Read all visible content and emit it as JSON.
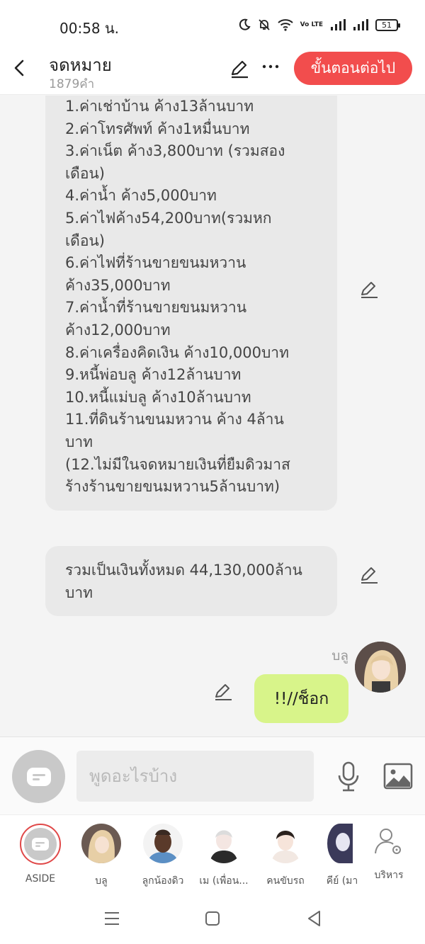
{
  "status_bar": {
    "time": "00:58 น.",
    "battery": "51",
    "network_label": "Vo LTE"
  },
  "header": {
    "title": "จดหมาย",
    "subtitle": "1879คำ",
    "next_button": "ขั้นตอนต่อไป"
  },
  "messages": {
    "first": {
      "lines": [
        "1.ค่าเช่าบ้าน ค้าง13ล้านบาท",
        "2.ค่าโทรศัพท์ ค้าง1หมื่นบาท",
        "3.ค่าเน็ต ค้าง3,800บาท (รวมสอง",
        "เดือน)",
        "4.ค่าน้ำ ค้าง5,000บาท",
        "5.ค่าไฟค้าง54,200บาท(รวมหก",
        "เดือน)",
        "6.ค่าไฟที่ร้านขายขนมหวาน",
        "ค้าง35,000บาท",
        "7.ค่าน้ำที่ร้านขายขนมหวาน",
        "ค้าง12,000บาท",
        "8.ค่าเครื่องคิดเงิน ค้าง10,000บาท",
        "9.หนี้พ่อบลู ค้าง12ล้านบาท",
        "10.หนี้แม่บลู ค้าง10ล้านบาท",
        "11.ที่ดินร้านขนมหวาน ค้าง 4ล้าน",
        "บาท",
        "(12.ไม่มีในจดหมายเงินที่ยืมดิวมาส",
        "ร้างร้านขายขนมหวาน5ล้านบาท)"
      ]
    },
    "second": {
      "lines": [
        "รวมเป็นเงินทั้งหมด 44,130,000ล้าน",
        "บาท"
      ]
    },
    "reply": {
      "sender": "บลู",
      "text": "!!//ช็อก"
    }
  },
  "input": {
    "placeholder": "พูดอะไรบ้าง"
  },
  "characters": [
    {
      "label": "ASIDE",
      "type": "aside"
    },
    {
      "label": "บลู",
      "color": "#6b5a52",
      "hair": "#e7cfa6"
    },
    {
      "label": "ลูกน้องดิว",
      "color": "#5b8fc4",
      "hair": "#3a2a22"
    },
    {
      "label": "เม (เพื่อน...",
      "color": "#2b2b2b",
      "hair": "#dcdcdc"
    },
    {
      "label": "คนขับรถ",
      "color": "#f2e8e2",
      "hair": "#2a211d"
    },
    {
      "label": "คีย์ (มา",
      "color": "#3b3a5a",
      "hair": "#e6e6f2"
    },
    {
      "label": "บริหาร",
      "type": "manage"
    }
  ],
  "icons": {
    "back": "chevron-left-icon",
    "edit": "pencil-icon",
    "more": "more-dots-icon",
    "mic": "microphone-icon",
    "image": "image-icon",
    "manage": "user-settings-icon"
  },
  "colors": {
    "accent": "#f24d4d",
    "reply_bubble": "#d8f48a",
    "message_bubble": "#e9e9e9"
  }
}
